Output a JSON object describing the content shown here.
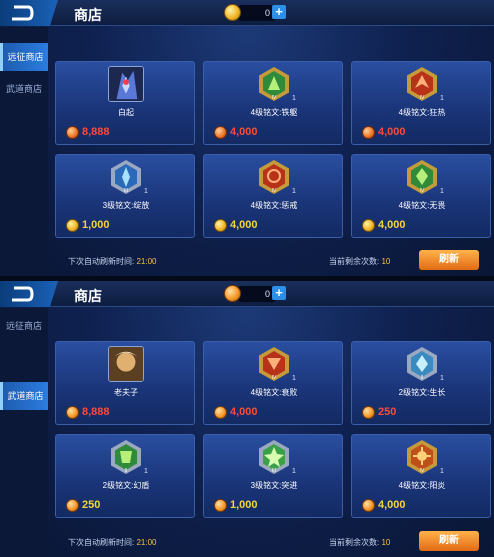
{
  "panels": [
    {
      "title": "商店",
      "currency_value": "0",
      "currency_add": "+",
      "sidebar": [
        {
          "label": "远征商店",
          "active": true
        },
        {
          "label": "武道商店",
          "active": false
        }
      ],
      "items": [
        {
          "name": "白起",
          "price": "8,888",
          "currency": "red-coin",
          "icon": "hero-baiqi-portrait",
          "qty": ""
        },
        {
          "name": "4级铭文:铁躯",
          "price": "4,000",
          "currency": "red-coin",
          "icon": "green-hexagon-rune-icon",
          "qty": "1"
        },
        {
          "name": "4级铭文:狂热",
          "price": "4,000",
          "currency": "red-coin",
          "icon": "red-hexagon-rune-icon",
          "qty": "1"
        },
        {
          "name": "3级铭文:绽放",
          "price": "1,000",
          "currency": "gold-coin",
          "icon": "blue-hexagon-rune-icon",
          "qty": "1"
        },
        {
          "name": "4级铭文:惩戒",
          "price": "4,000",
          "currency": "gold-coin",
          "icon": "red-hexagon-rune-icon",
          "qty": "1"
        },
        {
          "name": "4级铭文:无畏",
          "price": "4,000",
          "currency": "gold-coin",
          "icon": "green-hexagon-rune-icon",
          "qty": "1"
        }
      ],
      "footer_refresh_label": "下次自动刷新时间:",
      "footer_refresh_time": "21:00",
      "footer_remaining_label": "当前剩余次数:",
      "footer_remaining_count": "10",
      "refresh_button": "刷新"
    },
    {
      "title": "商店",
      "currency_value": "0",
      "currency_add": "+",
      "sidebar": [
        {
          "label": "远征商店",
          "active": false
        },
        {
          "label": "武道商店",
          "active": true
        }
      ],
      "items": [
        {
          "name": "老夫子",
          "price": "8,888",
          "currency": "orange-coin",
          "icon": "hero-laofuzi-portrait",
          "qty": ""
        },
        {
          "name": "4级铭文:衰败",
          "price": "4,000",
          "currency": "orange-coin",
          "icon": "red-hexagon-rune-icon",
          "qty": "1"
        },
        {
          "name": "2级铭文:生长",
          "price": "250",
          "currency": "orange-coin",
          "icon": "blue-hexagon-rune-icon",
          "qty": "1"
        },
        {
          "name": "2级铭文:幻盾",
          "price": "250",
          "currency": "orange-coin",
          "icon": "green-hexagon-rune-icon",
          "qty": "1"
        },
        {
          "name": "3级铭文:突进",
          "price": "1,000",
          "currency": "orange-coin",
          "icon": "green-hexagon-rune-icon",
          "qty": "1"
        },
        {
          "name": "4级铭文:阳炎",
          "price": "4,000",
          "currency": "orange-coin",
          "icon": "red-hexagon-rune-icon",
          "qty": "1"
        }
      ],
      "footer_refresh_label": "下次自动刷新时间:",
      "footer_refresh_time": "21:00",
      "footer_remaining_label": "当前剩余次数:",
      "footer_remaining_count": "10",
      "refresh_button": "刷新"
    }
  ],
  "colors": {
    "price_red": "#ff4a3a",
    "price_gold": "#f5d43a",
    "accent_blue": "#2b7de0",
    "refresh_orange": "#e26a14"
  }
}
